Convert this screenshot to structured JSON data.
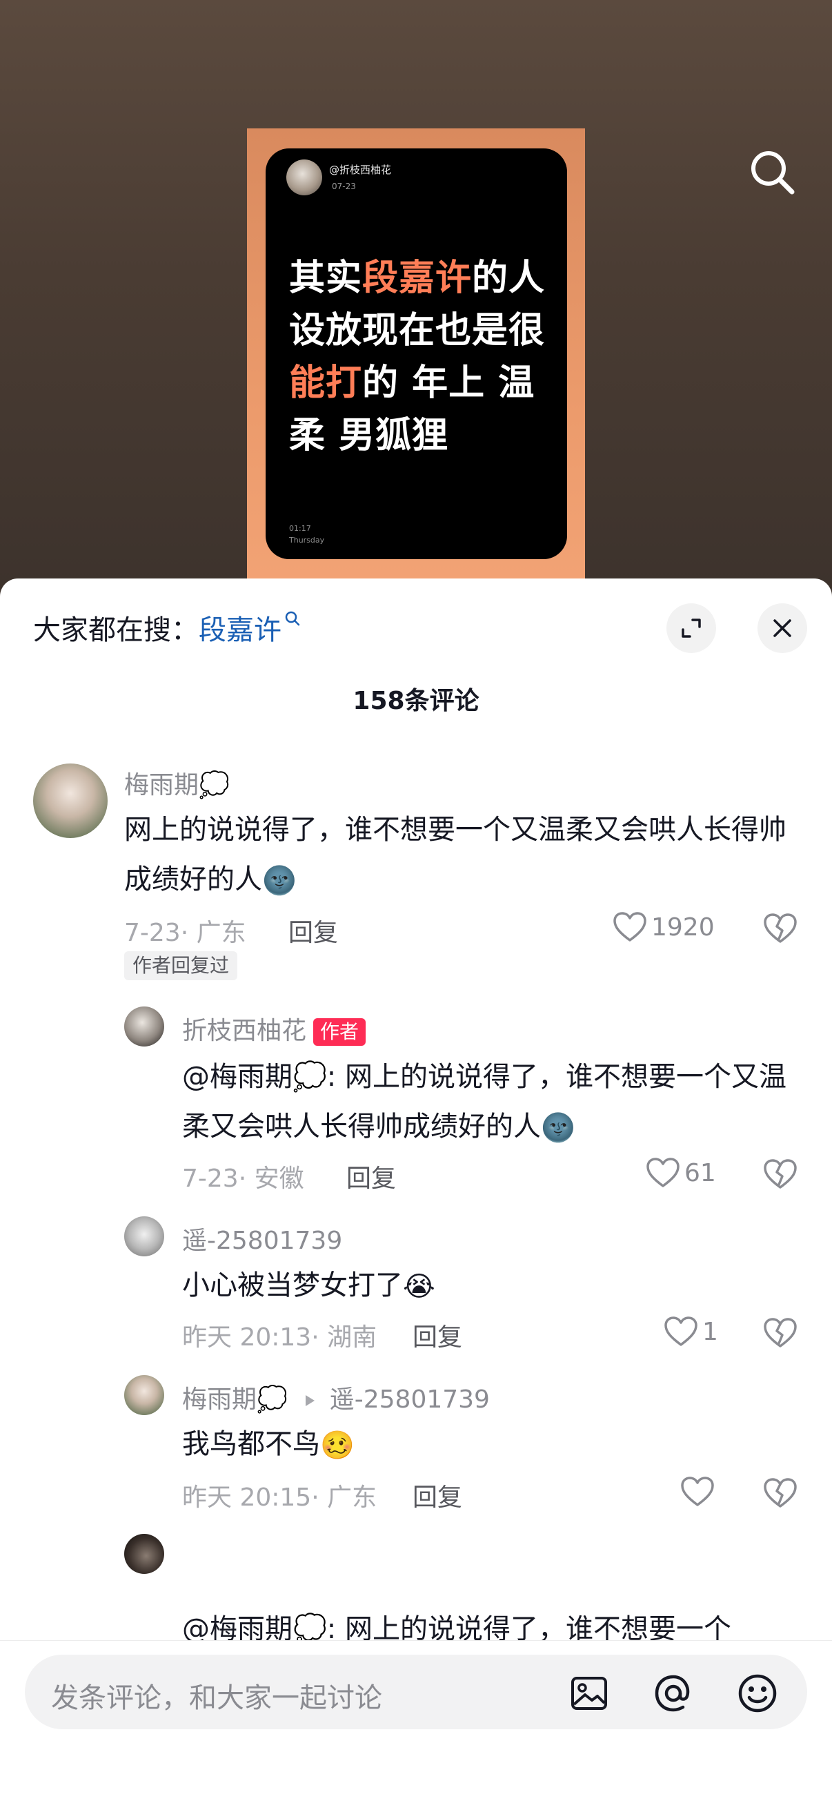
{
  "video": {
    "card_username": "@折枝西柚花",
    "card_date": "07-23",
    "card_text_parts": [
      {
        "text": "其实",
        "hl": false
      },
      {
        "text": "段嘉许",
        "hl": true
      },
      {
        "text": "的人设放现在也是很",
        "hl": false
      },
      {
        "text": "能打",
        "hl": true
      },
      {
        "text": "的 年上 温柔 男狐狸",
        "hl": false
      }
    ],
    "card_time": "01:17",
    "card_day": "Thursday"
  },
  "sheet": {
    "search_hint_label": "大家都在搜",
    "search_hint_colon": "：",
    "search_keyword": "段嘉许",
    "comment_count": "158条评论"
  },
  "comments": [
    {
      "username": "梅雨期💭",
      "text": "网上的说说得了，谁不想要一个又温柔又会哄人长得帅成绩好的人",
      "emoji": "🌚",
      "date_location": "7-23· 广东",
      "reply_label": "回复",
      "likes": "1920",
      "author_replied": "作者回复过"
    },
    {
      "username": "折枝西柚花",
      "badge": "作者",
      "text": "@梅雨期💭: 网上的说说得了，谁不想要一个又温柔又会哄人长得帅成绩好的人",
      "emoji": "🌚",
      "date_location": "7-23· 安徽",
      "reply_label": "回复",
      "likes": "61"
    },
    {
      "username": "遥-25801739",
      "text": "小心被当梦女打了",
      "emoji": "😭",
      "date_location": "昨天 20:13· 湖南",
      "reply_label": "回复",
      "likes": "1"
    },
    {
      "username": "梅雨期💭",
      "reply_to": "遥-25801739",
      "text": "我鸟都不鸟",
      "emoji": "🥴",
      "date_location": "昨天 20:15· 广东",
      "reply_label": "回复",
      "likes": ""
    },
    {
      "username": "",
      "text": "@梅雨期💭: 网上的说说得了，谁不想要一个"
    }
  ],
  "input": {
    "placeholder": "发条评论，和大家一起讨论"
  },
  "icons": [
    "search-icon",
    "expand-icon",
    "close-icon",
    "heart-icon",
    "broken-heart-icon",
    "image-icon",
    "at-icon",
    "emoji-icon"
  ]
}
